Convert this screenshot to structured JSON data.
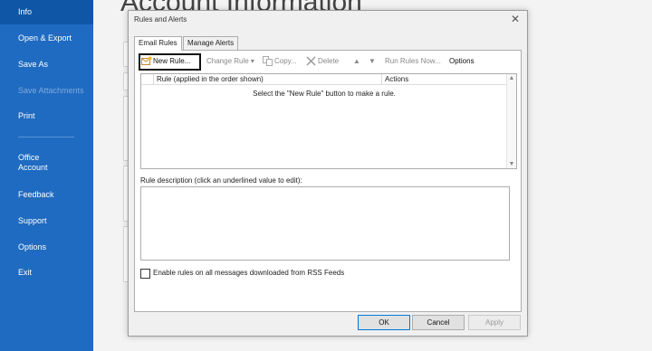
{
  "nav": {
    "items": [
      {
        "label": "Info"
      },
      {
        "label": "Open & Export"
      },
      {
        "label": "Save As"
      },
      {
        "label": "Save Attachments"
      },
      {
        "label": "Print"
      },
      {
        "label": "Office\nAccount"
      },
      {
        "label": "Feedback"
      },
      {
        "label": "Support"
      },
      {
        "label": "Options"
      },
      {
        "label": "Exit"
      }
    ]
  },
  "page": {
    "title": "Account Information"
  },
  "dialog": {
    "title": "Rules and Alerts",
    "tabs": [
      {
        "label": "Email Rules"
      },
      {
        "label": "Manage Alerts"
      }
    ],
    "toolbar": {
      "new_rule": "New Rule...",
      "change_rule": "Change Rule",
      "copy": "Copy...",
      "delete": "Delete",
      "run_rules_now": "Run Rules Now...",
      "options": "Options"
    },
    "list": {
      "columns": [
        "Rule (applied in the order shown)",
        "Actions"
      ],
      "empty_text": "Select the \"New Rule\" button to make a rule."
    },
    "description_label": "Rule description (click an underlined value to edit):",
    "rss_label": "Enable rules on all messages downloaded from RSS Feeds",
    "buttons": {
      "ok": "OK",
      "cancel": "Cancel",
      "apply": "Apply"
    }
  },
  "colors": {
    "nav_bg": "#1f6bc1",
    "accent": "#0078d7",
    "highlight_border": "#111111"
  }
}
